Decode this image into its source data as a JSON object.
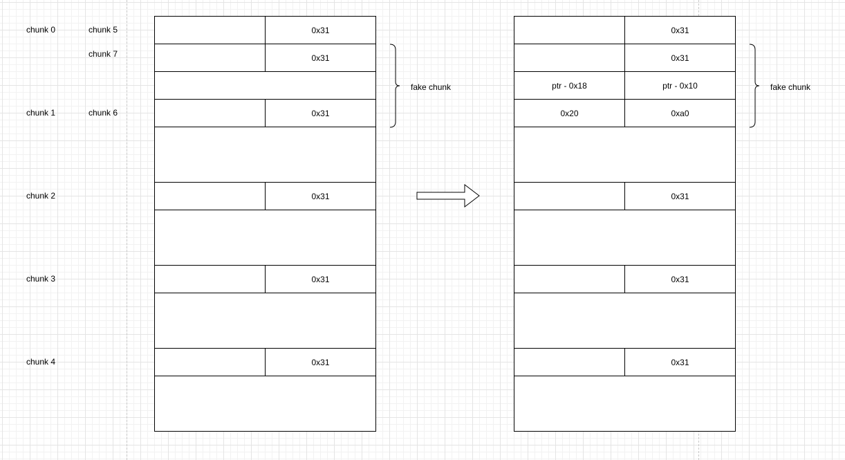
{
  "labels": {
    "chunk0": "chunk 0",
    "chunk5": "chunk 5",
    "chunk7": "chunk 7",
    "chunk1": "chunk 1",
    "chunk6": "chunk 6",
    "chunk2": "chunk 2",
    "chunk3": "chunk 3",
    "chunk4": "chunk 4"
  },
  "left": {
    "size_field": "0x31"
  },
  "right": {
    "size_field": "0x31",
    "fd_value": "ptr - 0x18",
    "bk_value": "ptr - 0x10",
    "prev_size": "0x20",
    "size_a0": "0xa0"
  },
  "fake_chunk_label": "fake chunk"
}
